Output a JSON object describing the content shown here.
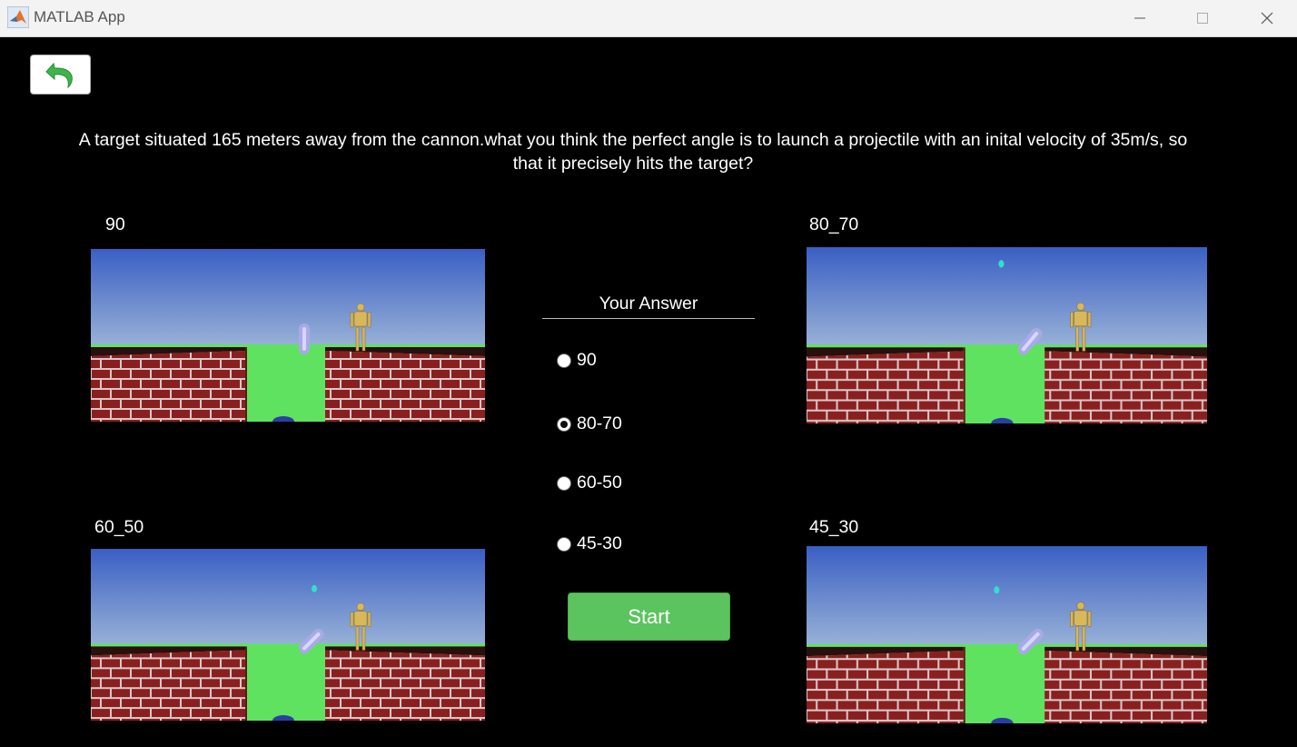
{
  "window": {
    "title": "MATLAB App"
  },
  "back_button": {
    "icon": "undo-arrow-icon",
    "color": "#3cb54a"
  },
  "question": "A target situated 165 meters away from the cannon.what you think the perfect angle is to launch a projectile with an inital velocity of 35m/s, so that it precisely hits the target?",
  "scenes": [
    {
      "label": "90",
      "cannon_angle_deg": 90,
      "projectile_visible": false
    },
    {
      "label": "80_70",
      "cannon_angle_deg": 50,
      "projectile_visible": true
    },
    {
      "label": "60_50",
      "cannon_angle_deg": 45,
      "projectile_visible": true
    },
    {
      "label": "45_30",
      "cannon_angle_deg": 45,
      "projectile_visible": true
    }
  ],
  "answer_panel": {
    "title": "Your Answer",
    "options": [
      "90",
      "80-70",
      "60-50",
      "45-30"
    ],
    "selected": "80-70",
    "start_label": "Start"
  },
  "colors": {
    "start_button": "#5cc45e",
    "background": "#000000"
  }
}
